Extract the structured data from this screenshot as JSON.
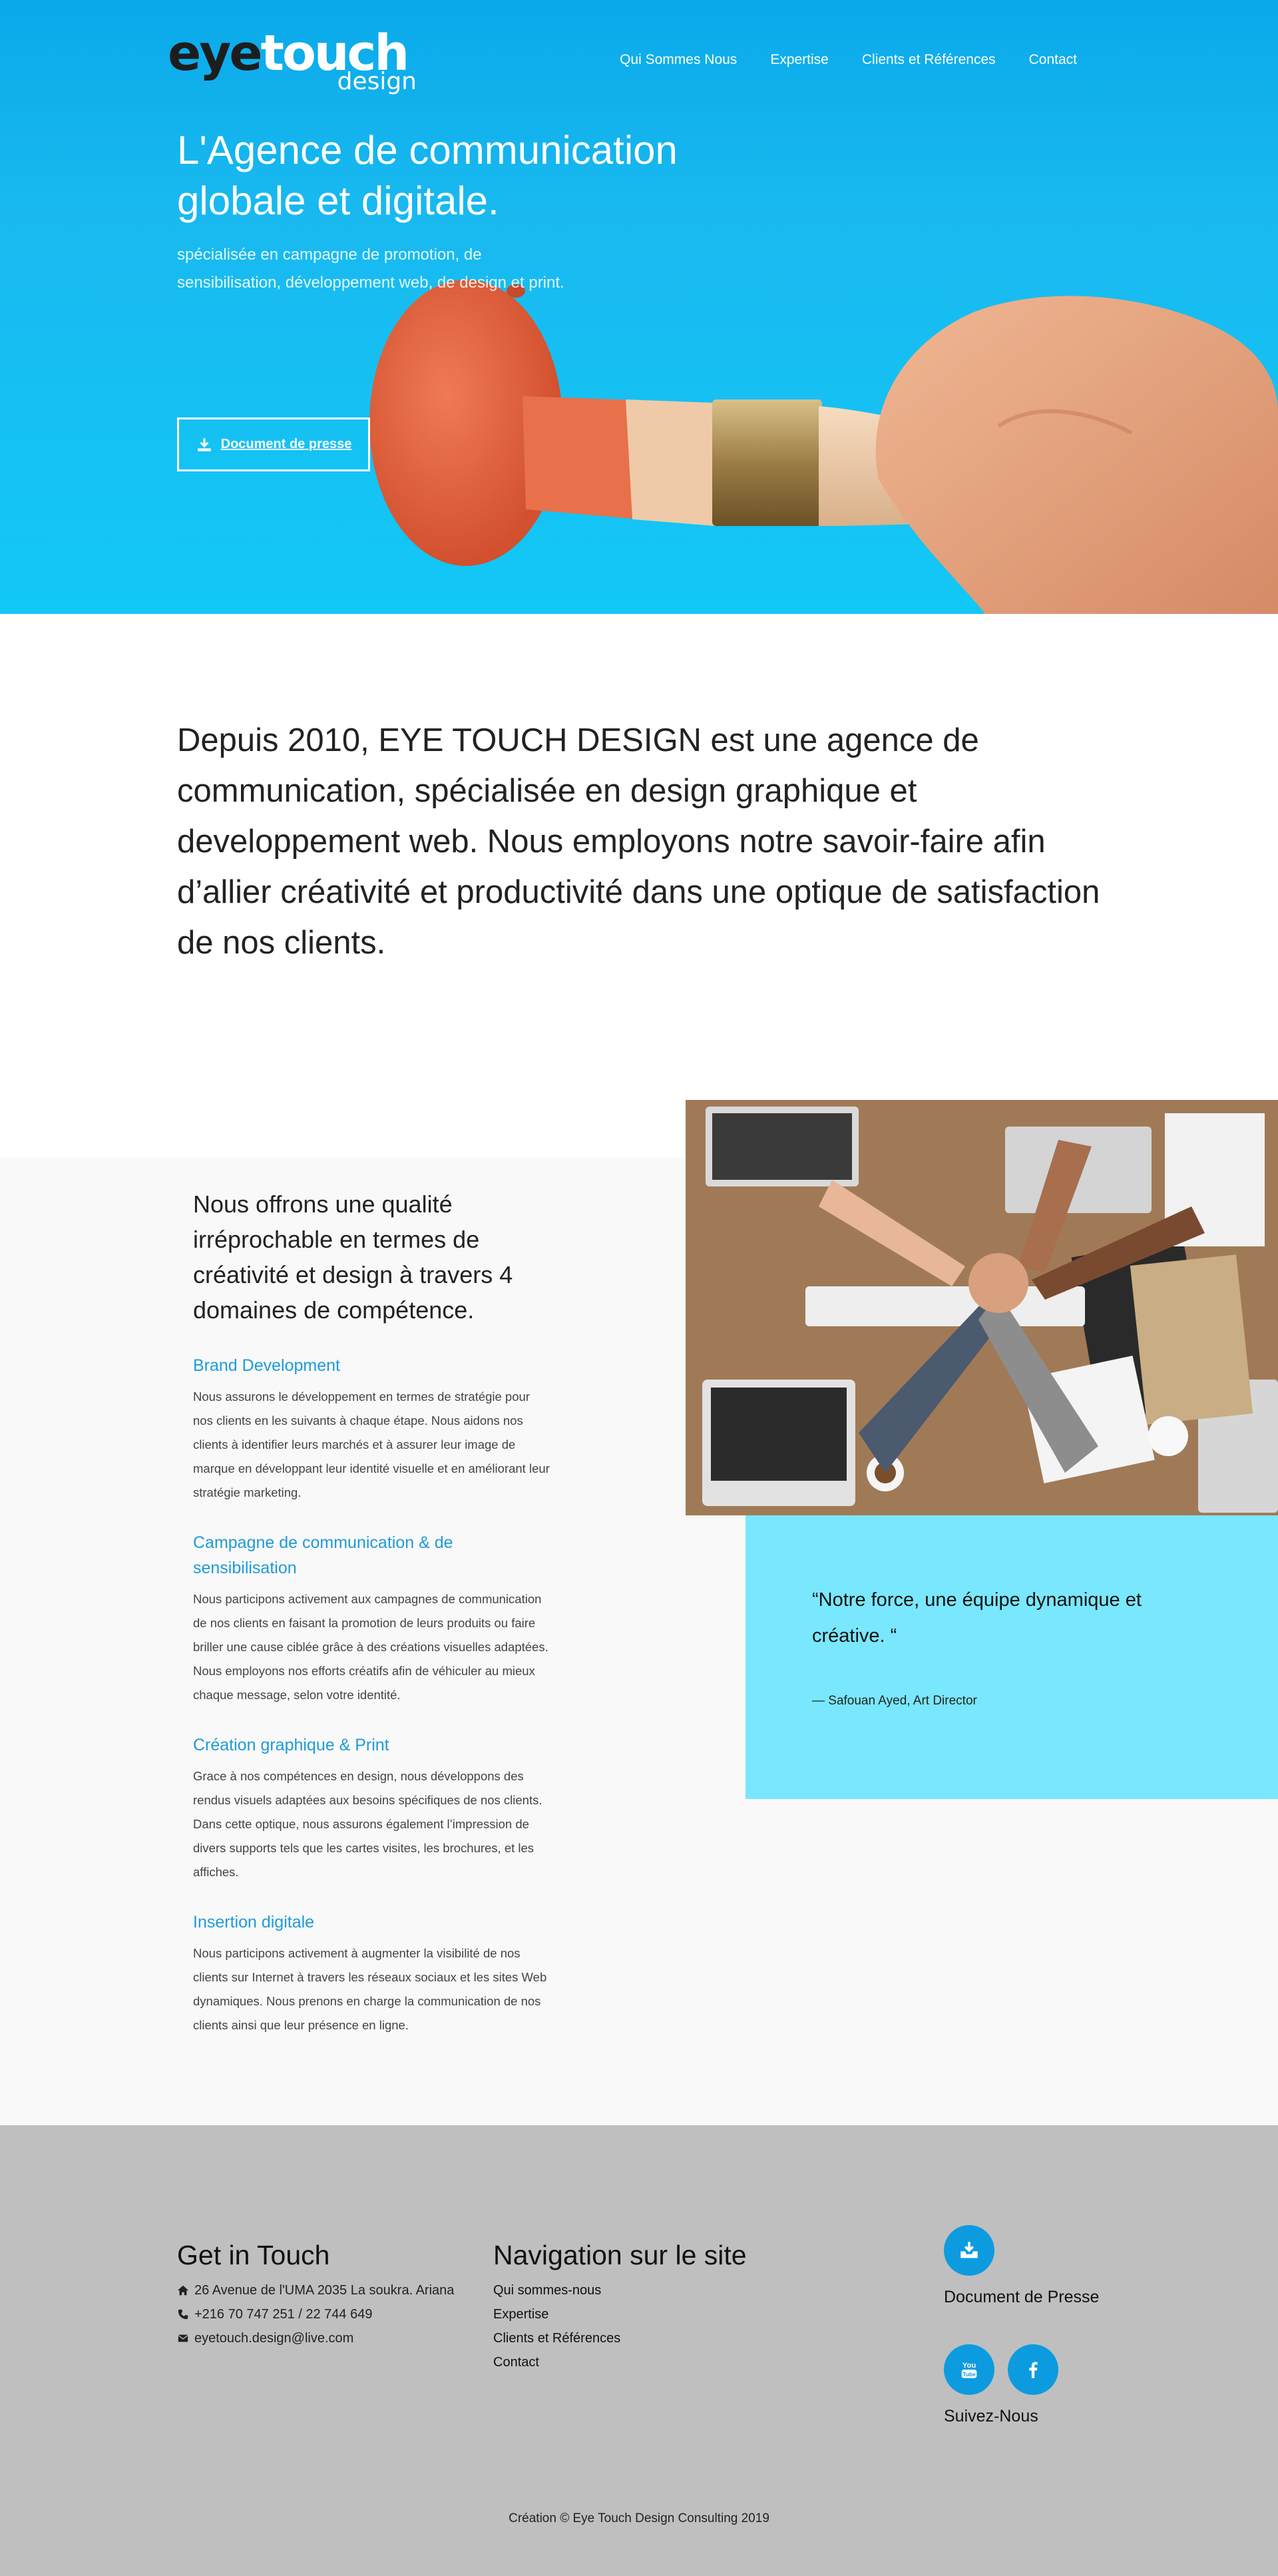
{
  "header": {
    "logo": {
      "part1": "eye",
      "part2": "touch",
      "sub": "design"
    },
    "nav": [
      "Qui Sommes Nous",
      "Expertise",
      "Clients et Références",
      "Contact"
    ]
  },
  "hero": {
    "title": "L'Agence de communication globale et digitale.",
    "subtitle": "spécialisée en campagne de promotion, de sensibilisation, développement web, de design et print.",
    "button_label": "Document de presse",
    "button_icon": "download-icon"
  },
  "intro": {
    "text": "Depuis 2010, EYE TOUCH DESIGN est une agence de communication, spécialisée en design graphique et developpement web. Nous employons notre savoir-faire afin d’allier créativité et productivité dans une optique de satisfaction de nos clients."
  },
  "services": {
    "intro": "Nous offrons une qualité irréprochable en termes de créativité et design à travers 4 domaines de compétence.",
    "items": [
      {
        "title": "Brand Development",
        "text": "Nous assurons le développement en termes de stratégie pour nos clients en les suivants à chaque étape. Nous aidons nos clients à identifier leurs marchés et à assurer leur image de marque en développant leur identité visuelle et en améliorant leur stratégie marketing."
      },
      {
        "title": "Campagne de communication & de sensibilisation",
        "text": "Nous participons activement aux campagnes de communication de nos clients en faisant la promotion de leurs produits ou faire briller une cause ciblée grâce à des créations visuelles adaptées. Nous employons nos efforts créatifs afin de véhiculer au mieux chaque message, selon votre identité."
      },
      {
        "title": "Création graphique & Print",
        "text": "Grace à nos compétences en design, nous développons des rendus visuels adaptées aux besoins spécifiques de nos clients. Dans cette optique, nous assurons également l’impression de divers supports tels que les cartes visites, les brochures, et les affiches."
      },
      {
        "title": "Insertion digitale",
        "text": "Nous participons activement à augmenter la visibilité de nos clients sur Internet à travers les réseaux sociaux et les sites Web dynamiques. Nous prenons en charge la communication de nos clients ainsi que leur présence en ligne."
      }
    ]
  },
  "quote": {
    "text": "“Notre force, une équipe dynamique et créative. “",
    "author": "— Safouan Ayed, Art Director"
  },
  "footer": {
    "contact": {
      "heading": "Get in Touch",
      "address": "26 Avenue de l'UMA 2035 La soukra. Ariana",
      "phone": "+216 70 747 251 / 22 744 649",
      "email": "eyetouch.design@live.com"
    },
    "navigation": {
      "heading": "Navigation sur le site",
      "links": [
        "Qui sommes-nous",
        "Expertise",
        "Clients et Références",
        "Contact"
      ]
    },
    "press_label": "Document de Presse",
    "follow_label": "Suivez-Nous",
    "copyright": "Création © Eye Touch Design Consulting 2019"
  },
  "colors": {
    "hero_blue": "#12b4ef",
    "accent_blue": "#1e9bd7",
    "quote_bg": "#79e7fd",
    "footer_bg": "#bfbfbf",
    "icon_circle": "#0d9be0"
  }
}
